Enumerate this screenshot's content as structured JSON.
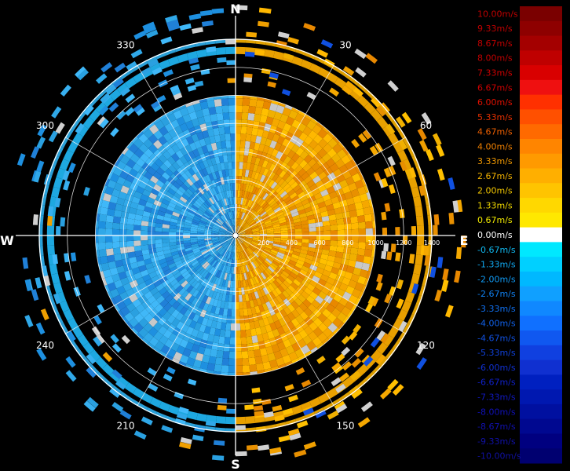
{
  "chart_data": {
    "type": "heatmap",
    "projection": "polar-ppi",
    "quantity": "radial velocity",
    "cardinals": {
      "north": "N",
      "east": "E",
      "south": "S",
      "west": "W"
    },
    "azimuth_labels": [
      "30",
      "60",
      "120",
      "150",
      "210",
      "240",
      "300",
      "330"
    ],
    "azimuth_label_angles": [
      30,
      60,
      120,
      150,
      210,
      240,
      300,
      330
    ],
    "range_labels": [
      "200",
      "400",
      "600",
      "800",
      "1000",
      "1200",
      "1400"
    ],
    "range_values": [
      200,
      400,
      600,
      800,
      1000,
      1200,
      1400
    ],
    "range_max": 1400,
    "colorbar": {
      "levels": [
        "10.00m/s",
        "9.33m/s",
        "8.67m/s",
        "8.00m/s",
        "7.33m/s",
        "6.67m/s",
        "6.00m/s",
        "5.33m/s",
        "4.67m/s",
        "4.00m/s",
        "3.33m/s",
        "2.67m/s",
        "2.00m/s",
        "1.33m/s",
        "0.67m/s",
        "0.00m/s",
        "-0.67m/s",
        "-1.33m/s",
        "-2.00m/s",
        "-2.67m/s",
        "-3.33m/s",
        "-4.00m/s",
        "-4.67m/s",
        "-5.33m/s",
        "-6.00m/s",
        "-6.67m/s",
        "-7.33m/s",
        "-8.00m/s",
        "-8.67m/s",
        "-9.33m/s",
        "-10.00m/s"
      ],
      "colors": [
        "#7a0000",
        "#8e0000",
        "#a40000",
        "#bf0000",
        "#d90000",
        "#ef1010",
        "#ff3000",
        "#ff5000",
        "#ff6a00",
        "#ff8500",
        "#ff9a00",
        "#ffaf00",
        "#ffc400",
        "#ffd800",
        "#ffe800",
        "#ffffff",
        "#00e8ff",
        "#00d0ff",
        "#00b8ff",
        "#10a0ff",
        "#1088ff",
        "#1070ff",
        "#1058f0",
        "#1040e0",
        "#1030d0",
        "#0020c0",
        "#0018b0",
        "#0010a0",
        "#000890",
        "#000080",
        "#000070"
      ],
      "label_colors": [
        "#c00000",
        "#c00000",
        "#c00000",
        "#c00000",
        "#d00000",
        "#d00000",
        "#e01000",
        "#e83000",
        "#f06000",
        "#f08000",
        "#f09800",
        "#f0b000",
        "#f0c400",
        "#f0d800",
        "#f0e800",
        "#ffffff",
        "#10b8f0",
        "#10a8f0",
        "#1098f0",
        "#1080f0",
        "#1070f0",
        "#1060e8",
        "#1050e0",
        "#1040d8",
        "#1030d0",
        "#1020c8",
        "#1018c0",
        "#1010b8",
        "#1010b0",
        "#1010a8",
        "#1010a0"
      ]
    },
    "grid": true,
    "dense_region_max_range": 1000,
    "sparse_rings": [
      {
        "range": 1320,
        "color": "#1ea8e0",
        "west_color": "#1ea8e0",
        "east_color": "#e8a000",
        "width": 9
      },
      {
        "range": 1390,
        "color": "#2aa0d8",
        "west_color": "#2aa0d8",
        "east_color": "#e0a000",
        "width": 5
      }
    ]
  }
}
